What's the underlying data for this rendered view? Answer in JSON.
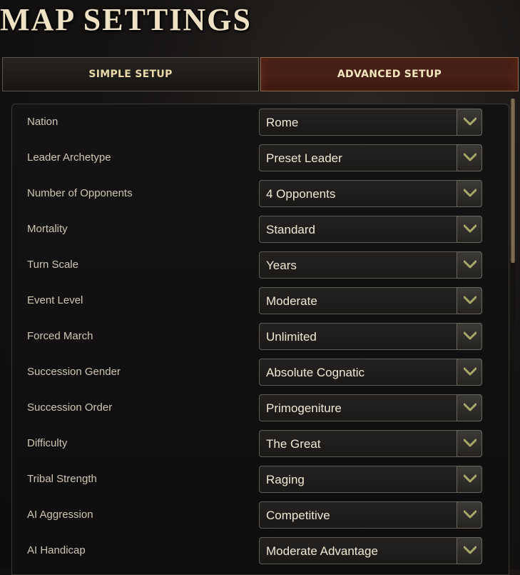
{
  "title": "MAP SETTINGS",
  "tabs": [
    {
      "label": "SIMPLE SETUP",
      "active": false
    },
    {
      "label": "ADVANCED SETUP",
      "active": true
    }
  ],
  "settings": [
    {
      "label": "Nation",
      "value": "Rome"
    },
    {
      "label": "Leader Archetype",
      "value": "Preset Leader"
    },
    {
      "label": "Number of Opponents",
      "value": "4 Opponents"
    },
    {
      "label": "Mortality",
      "value": "Standard"
    },
    {
      "label": "Turn Scale",
      "value": "Years"
    },
    {
      "label": "Event Level",
      "value": "Moderate"
    },
    {
      "label": "Forced March",
      "value": "Unlimited"
    },
    {
      "label": "Succession Gender",
      "value": "Absolute Cognatic"
    },
    {
      "label": "Succession Order",
      "value": "Primogeniture"
    },
    {
      "label": "Difficulty",
      "value": "The Great"
    },
    {
      "label": "Tribal Strength",
      "value": "Raging"
    },
    {
      "label": "AI Aggression",
      "value": "Competitive"
    },
    {
      "label": "AI Handicap",
      "value": "Moderate Advantage"
    }
  ],
  "colors": {
    "accent_gold": "#e8d9a8",
    "chevron_olive": "#a8a86a",
    "active_tab": "#4a2119"
  },
  "icons": {
    "dropdown": "chevron-down-icon"
  }
}
